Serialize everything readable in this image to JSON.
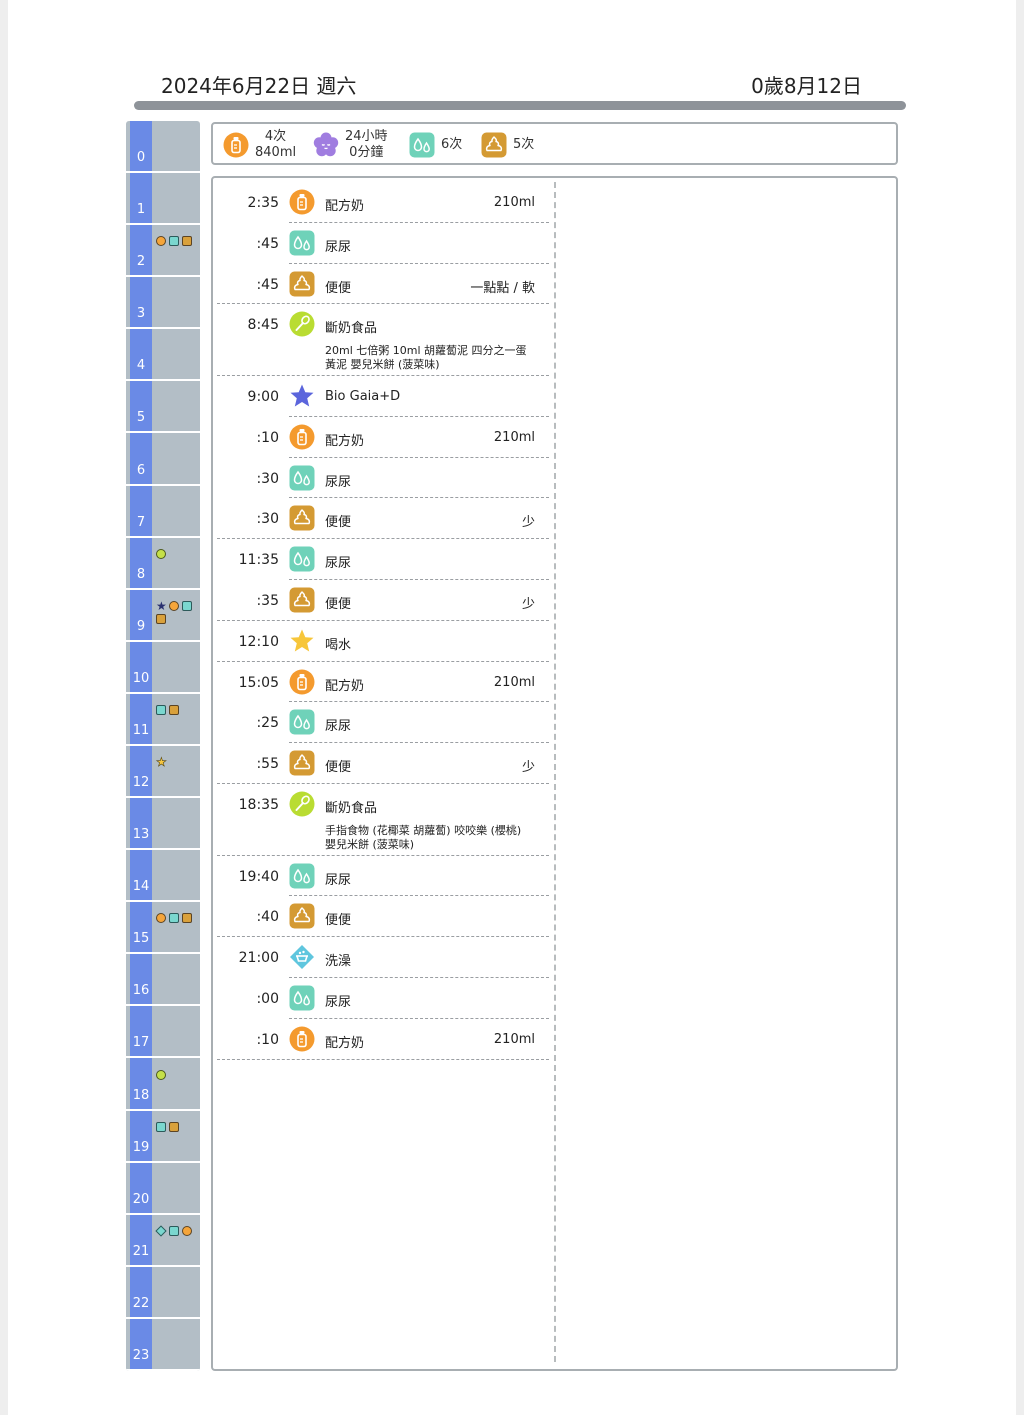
{
  "header": {
    "date": "2024年6月22日 週六",
    "age": "0歲8月12日"
  },
  "summary": {
    "feed_count": "4次",
    "feed_volume": "840ml",
    "sleep_hours": "24小時",
    "sleep_minutes": "0分鐘",
    "pee_count": "6次",
    "poop_count": "5次"
  },
  "hours": [
    {
      "label": "0",
      "marks": []
    },
    {
      "label": "1",
      "marks": []
    },
    {
      "label": "2",
      "marks": [
        "circle-orange",
        "square-teal",
        "square-brown"
      ]
    },
    {
      "label": "3",
      "marks": []
    },
    {
      "label": "4",
      "marks": []
    },
    {
      "label": "5",
      "marks": []
    },
    {
      "label": "6",
      "marks": []
    },
    {
      "label": "7",
      "marks": []
    },
    {
      "label": "8",
      "marks": [
        "circle-green"
      ]
    },
    {
      "label": "9",
      "marks": [
        "star-navy",
        "circle-orange",
        "square-teal",
        "square-brown"
      ]
    },
    {
      "label": "10",
      "marks": []
    },
    {
      "label": "11",
      "marks": [
        "square-teal",
        "square-brown"
      ]
    },
    {
      "label": "12",
      "marks": [
        "star-yellow"
      ]
    },
    {
      "label": "13",
      "marks": []
    },
    {
      "label": "14",
      "marks": []
    },
    {
      "label": "15",
      "marks": [
        "circle-orange",
        "square-teal",
        "square-brown"
      ]
    },
    {
      "label": "16",
      "marks": []
    },
    {
      "label": "17",
      "marks": []
    },
    {
      "label": "18",
      "marks": [
        "circle-green"
      ]
    },
    {
      "label": "19",
      "marks": [
        "square-teal",
        "square-brown"
      ]
    },
    {
      "label": "20",
      "marks": []
    },
    {
      "label": "21",
      "marks": [
        "diamond-teal",
        "square-teal",
        "circle-orange"
      ]
    },
    {
      "label": "22",
      "marks": []
    },
    {
      "label": "23",
      "marks": []
    }
  ],
  "entries": [
    {
      "time": "2:35",
      "icon": "bottle-icon",
      "label": "配方奶",
      "value": "210ml",
      "note": "",
      "end": false
    },
    {
      "time": ":45",
      "icon": "pee-icon",
      "label": "尿尿",
      "value": "",
      "note": "",
      "end": false
    },
    {
      "time": ":45",
      "icon": "poop-icon",
      "label": "便便",
      "value": "一點點 / 軟",
      "note": "",
      "end": true
    },
    {
      "time": "8:45",
      "icon": "spoon-icon",
      "label": "斷奶食品",
      "value": "",
      "note": "20ml 七倍粥 10ml 胡蘿蔔泥 四分之一蛋黃泥 嬰兒米餅 (菠菜味)",
      "end": true
    },
    {
      "time": "9:00",
      "icon": "star-medicine-icon",
      "label": "Bio Gaia+D",
      "value": "",
      "note": "",
      "end": false
    },
    {
      "time": ":10",
      "icon": "bottle-icon",
      "label": "配方奶",
      "value": "210ml",
      "note": "",
      "end": false
    },
    {
      "time": ":30",
      "icon": "pee-icon",
      "label": "尿尿",
      "value": "",
      "note": "",
      "end": false
    },
    {
      "time": ":30",
      "icon": "poop-icon",
      "label": "便便",
      "value": "少",
      "note": "",
      "end": true
    },
    {
      "time": "11:35",
      "icon": "pee-icon",
      "label": "尿尿",
      "value": "",
      "note": "",
      "end": false
    },
    {
      "time": ":35",
      "icon": "poop-icon",
      "label": "便便",
      "value": "少",
      "note": "",
      "end": true
    },
    {
      "time": "12:10",
      "icon": "star-water-icon",
      "label": "喝水",
      "value": "",
      "note": "",
      "end": true
    },
    {
      "time": "15:05",
      "icon": "bottle-icon",
      "label": "配方奶",
      "value": "210ml",
      "note": "",
      "end": false
    },
    {
      "time": ":25",
      "icon": "pee-icon",
      "label": "尿尿",
      "value": "",
      "note": "",
      "end": false
    },
    {
      "time": ":55",
      "icon": "poop-icon",
      "label": "便便",
      "value": "少",
      "note": "",
      "end": true
    },
    {
      "time": "18:35",
      "icon": "spoon-icon",
      "label": "斷奶食品",
      "value": "",
      "note": "手指食物 (花椰菜 胡蘿蔔) 咬咬樂 (櫻桃) 嬰兒米餅 (菠菜味)",
      "end": true
    },
    {
      "time": "19:40",
      "icon": "pee-icon",
      "label": "尿尿",
      "value": "",
      "note": "",
      "end": false
    },
    {
      "time": ":40",
      "icon": "poop-icon",
      "label": "便便",
      "value": "",
      "note": "",
      "end": true
    },
    {
      "time": "21:00",
      "icon": "bath-icon",
      "label": "洗澡",
      "value": "",
      "note": "",
      "end": false
    },
    {
      "time": ":00",
      "icon": "pee-icon",
      "label": "尿尿",
      "value": "",
      "note": "",
      "end": false
    },
    {
      "time": ":10",
      "icon": "bottle-icon",
      "label": "配方奶",
      "value": "210ml",
      "note": "",
      "end": true
    }
  ]
}
